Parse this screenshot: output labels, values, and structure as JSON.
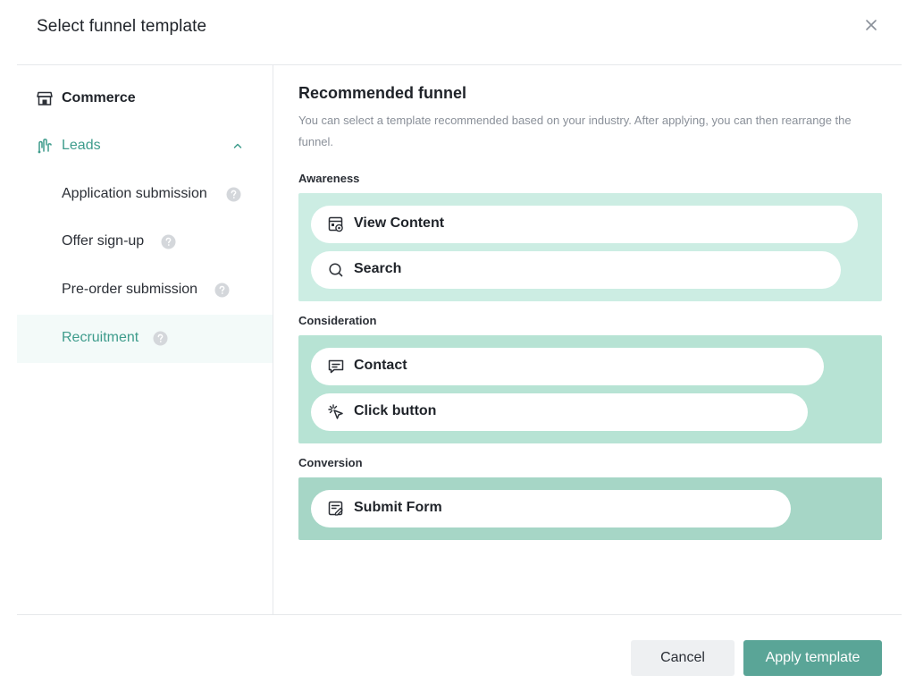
{
  "dialog": {
    "title": "Select funnel template"
  },
  "sidebar": {
    "categories": [
      {
        "label": "Commerce",
        "icon": "store-icon"
      },
      {
        "label": "Leads",
        "icon": "funnel-leads-icon",
        "expanded": true
      }
    ],
    "subitems": [
      {
        "label": "Application submission"
      },
      {
        "label": "Offer sign-up"
      },
      {
        "label": "Pre-order submission"
      },
      {
        "label": "Recruitment",
        "selected": true
      }
    ]
  },
  "main": {
    "title": "Recommended funnel",
    "description": "You can select a template recommended based on your industry. After applying, you can then rearrange the funnel.",
    "stages": [
      {
        "label": "Awareness",
        "color": "#ccede3",
        "events": [
          {
            "label": "View Content",
            "icon": "view-content-icon"
          },
          {
            "label": "Search",
            "icon": "search-icon"
          }
        ]
      },
      {
        "label": "Consideration",
        "color": "#b7e3d4",
        "events": [
          {
            "label": "Contact",
            "icon": "chat-icon"
          },
          {
            "label": "Click button",
            "icon": "click-icon"
          }
        ]
      },
      {
        "label": "Conversion",
        "color": "#a6d6c6",
        "events": [
          {
            "label": "Submit Form",
            "icon": "form-icon"
          }
        ]
      }
    ]
  },
  "footer": {
    "cancel_label": "Cancel",
    "apply_label": "Apply template"
  },
  "colors": {
    "accent": "#3e9c8c",
    "apply_button": "#5aa597",
    "selected_background": "#f3faf9"
  }
}
